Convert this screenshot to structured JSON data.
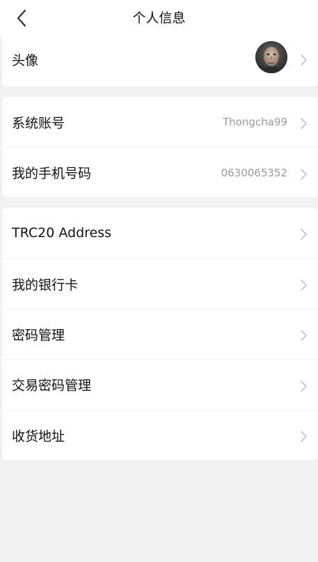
{
  "header": {
    "title": "个人信息",
    "back_icon": "chevron-left-icon"
  },
  "avatar_row": {
    "label": "头像",
    "avatar_icon": "user-photo",
    "chevron_icon": "chevron-right-icon"
  },
  "account": {
    "system_account_label": "系统账号",
    "system_account_value": "Thongcha99",
    "phone_label": "我的手机号码",
    "phone_value": "0630065352"
  },
  "menu": {
    "items": [
      {
        "label": "TRC20 Address"
      },
      {
        "label": "我的银行卡"
      },
      {
        "label": "密码管理"
      },
      {
        "label": "交易密码管理"
      },
      {
        "label": "收货地址"
      }
    ]
  },
  "colors": {
    "background": "#f2f2f2",
    "card": "#ffffff",
    "text_primary": "#111111",
    "text_secondary": "#9b9b9b",
    "chevron": "#c4c4c4"
  }
}
